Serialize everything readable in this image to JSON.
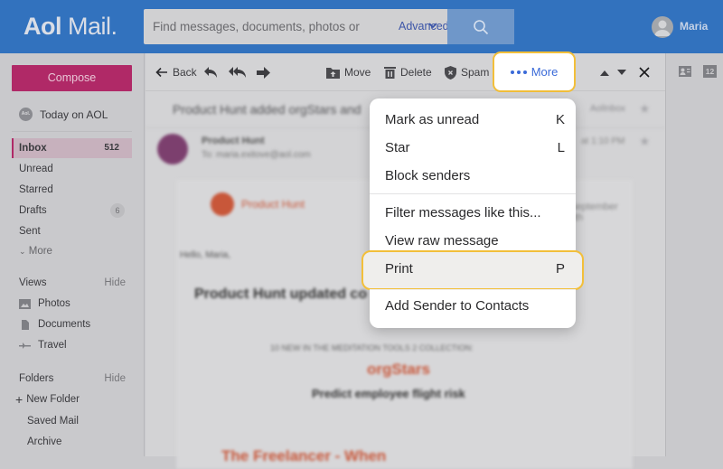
{
  "header": {
    "logo_brand": "Aol",
    "logo_product": "Mail.",
    "search_placeholder": "Find messages, documents, photos or pe",
    "advanced_label": "Advanced",
    "user_name": "Maria"
  },
  "sidebar": {
    "compose_label": "Compose",
    "today_label": "Today on AOL",
    "today_badge": "Aol.",
    "nav": [
      {
        "label": "Inbox",
        "count": "512"
      },
      {
        "label": "Unread"
      },
      {
        "label": "Starred"
      },
      {
        "label": "Drafts",
        "count": "6"
      },
      {
        "label": "Sent"
      },
      {
        "label": "More"
      }
    ],
    "views": {
      "title": "Views",
      "hide": "Hide",
      "items": [
        "Photos",
        "Documents",
        "Travel"
      ]
    },
    "folders": {
      "title": "Folders",
      "hide": "Hide",
      "new_folder": "New Folder",
      "items": [
        "Saved Mail",
        "Archive"
      ]
    }
  },
  "toolbar": {
    "back": "Back",
    "move": "Move",
    "delete": "Delete",
    "spam": "Spam",
    "more": "More"
  },
  "right_pane": {
    "calendar_day": "12"
  },
  "message": {
    "subject": "Product Hunt added orgStars and",
    "sender": "Product Hunt",
    "to": "To: maria.exitove@aol.com",
    "folder": "AolInbox",
    "date": "at 1:10 PM",
    "brand": "Product Hunt",
    "date2": "September 9th",
    "greeting": "Hello, Maria,",
    "headline": "Product Hunt updated co",
    "collection": "10 NEW IN THE MEDITATION TOOLS 2 COLLECTION:",
    "product": "orgStars",
    "tagline": "Predict employee flight risk",
    "card_title": "The Freelancer - When"
  },
  "menu": {
    "items": [
      {
        "label": "Mark as unread",
        "key": "K"
      },
      {
        "label": "Star",
        "key": "L"
      },
      {
        "label": "Block senders",
        "key": ""
      },
      {
        "label": "Filter messages like this...",
        "key": ""
      },
      {
        "label": "View raw message",
        "key": ""
      },
      {
        "label": "Print",
        "key": "P"
      },
      {
        "label": "Add Sender to Contacts",
        "key": ""
      }
    ]
  },
  "colors": {
    "topbar": "#3272be",
    "compose": "#b02967",
    "highlight": "#f2bf3a",
    "accent_link": "#3a6ad8"
  }
}
